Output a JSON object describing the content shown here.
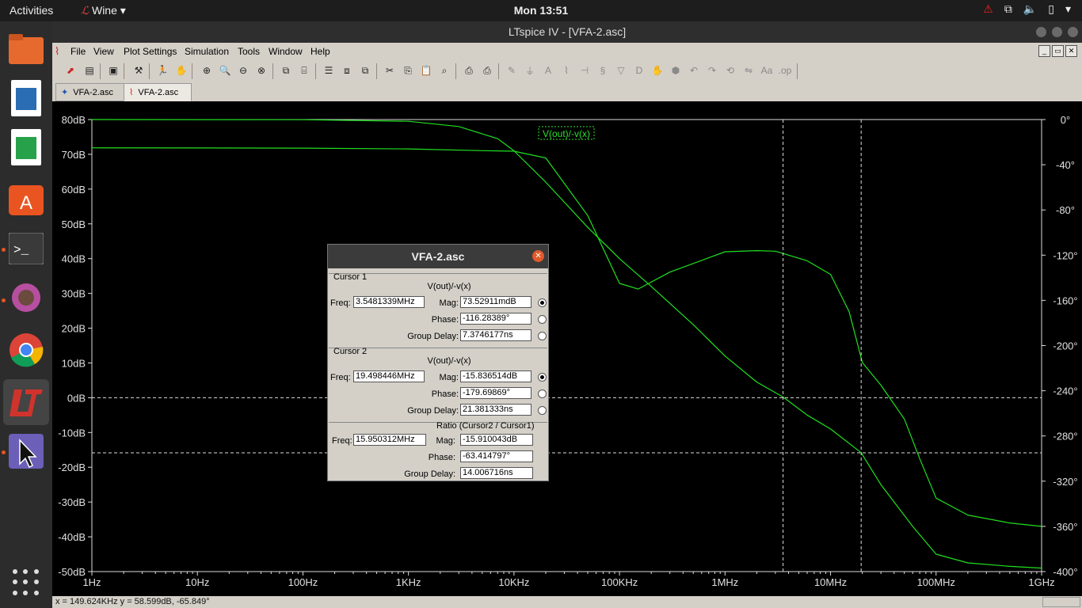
{
  "topbar": {
    "activities": "Activities",
    "app_name": "Wine",
    "clock": "Mon 13:51",
    "warning_icon": "warning-icon",
    "network_icon": "network-icon",
    "volume_icon": "volume-icon",
    "battery_icon": "battery-icon"
  },
  "dock": {
    "items": [
      "files-icon",
      "writer-icon",
      "calc-icon",
      "software-center-icon",
      "terminal-icon",
      "gimp-icon",
      "chrome-icon",
      "ltspice-icon",
      "screenshot-icon"
    ],
    "apps_icon": "show-applications-icon"
  },
  "window": {
    "title": "LTspice IV - [VFA-2.asc]",
    "menu": [
      "File",
      "View",
      "Plot Settings",
      "Simulation",
      "Tools",
      "Window",
      "Help"
    ],
    "tabs": [
      "VFA-2.asc",
      "VFA-2.asc"
    ],
    "status": "x = 149.624KHz    y = 58.599dB, -65.849°"
  },
  "chart_data": {
    "type": "line",
    "title": "V(out)/-v(x)",
    "x_scale": "log",
    "x_range_hz": [
      1,
      1000000000
    ],
    "x_ticks": [
      "1Hz",
      "10Hz",
      "100Hz",
      "1KHz",
      "10KHz",
      "100KHz",
      "1MHz",
      "10MHz",
      "100MHz",
      "1GHz"
    ],
    "y_left_ticks": [
      "80dB",
      "70dB",
      "60dB",
      "50dB",
      "40dB",
      "30dB",
      "20dB",
      "10dB",
      "0dB",
      "-10dB",
      "-20dB",
      "-30dB",
      "-40dB",
      "-50dB"
    ],
    "y_left_range_db": [
      -50,
      80
    ],
    "y_right_ticks": [
      "0°",
      "-40°",
      "-80°",
      "-120°",
      "-160°",
      "-200°",
      "-240°",
      "-280°",
      "-320°",
      "-360°",
      "-400°"
    ],
    "y_right_range_deg": [
      -400,
      0
    ],
    "color": "#20e020",
    "series": [
      {
        "name": "magnitude",
        "x": [
          1,
          100,
          1000,
          3000,
          7000,
          10000,
          20000,
          50000,
          100000,
          200000,
          500000,
          1000000,
          2000000,
          3548000,
          6000000,
          10000000,
          19500000,
          30000000,
          60000000,
          100000000,
          200000000,
          500000000,
          1000000000
        ],
        "y": [
          80,
          79.95,
          79.5,
          78,
          74.5,
          71,
          62,
          49,
          40,
          32,
          21,
          12,
          4.5,
          0.2,
          -5,
          -9,
          -15.8,
          -25,
          -37,
          -45,
          -47.5,
          -48.5,
          -49
        ]
      },
      {
        "name": "phase",
        "x": [
          1,
          100,
          1000,
          5000,
          10000,
          20000,
          50000,
          100000,
          150000,
          300000,
          1000000,
          2000000,
          3000000,
          6000000,
          10000000,
          15000000,
          20000000,
          30000000,
          50000000,
          70000000,
          100000000,
          200000000,
          500000000,
          1000000000
        ],
        "y": [
          -25,
          -25.3,
          -26,
          -27.5,
          -28,
          -34,
          -85,
          -145,
          -150,
          -135,
          -117,
          -116,
          -116.5,
          -125,
          -137,
          -170,
          -215,
          -235,
          -265,
          -300,
          -335,
          -350,
          -357,
          -360
        ]
      }
    ],
    "cursors": [
      {
        "freq_hz": 3548134,
        "mag_db": 0
      },
      {
        "freq_hz": 19498446,
        "mag_db": -15.84
      }
    ]
  },
  "dialog": {
    "title": "VFA-2.asc",
    "cursor1": {
      "label": "Cursor 1",
      "signal": "V(out)/-v(x)",
      "freq_label": "Freq:",
      "freq": "3.5481339MHz",
      "mag_label": "Mag:",
      "mag": "73.52911mdB",
      "phase_label": "Phase:",
      "phase": "-116.28389°",
      "gd_label": "Group Delay:",
      "gd": "7.3746177ns"
    },
    "cursor2": {
      "label": "Cursor 2",
      "signal": "V(out)/-v(x)",
      "freq_label": "Freq:",
      "freq": "19.498446MHz",
      "mag_label": "Mag:",
      "mag": "-15.836514dB",
      "phase_label": "Phase:",
      "phase": "-179.69869°",
      "gd_label": "Group Delay:",
      "gd": "21.381333ns"
    },
    "ratio": {
      "label": "Ratio (Cursor2 / Cursor1)",
      "freq_label": "Freq:",
      "freq": "15.950312MHz",
      "mag_label": "Mag:",
      "mag": "-15.910043dB",
      "phase_label": "Phase:",
      "phase": "-63.414797°",
      "gd_label": "Group Delay:",
      "gd": "14.006716ns"
    }
  }
}
